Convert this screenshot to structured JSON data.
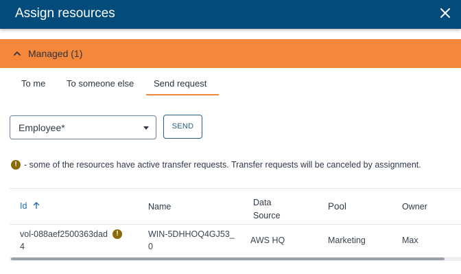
{
  "dialog": {
    "title": "Assign resources",
    "close_icon": "close-icon"
  },
  "section": {
    "label": "Managed (1)",
    "icon": "chevron-up-icon",
    "color": "#f5873a"
  },
  "tabs": [
    {
      "label": "To me",
      "active": false
    },
    {
      "label": "To someone else",
      "active": false
    },
    {
      "label": "Send request",
      "active": true
    }
  ],
  "form": {
    "employee_select": {
      "value": "Employee*"
    },
    "send_label": "SEND"
  },
  "notice": {
    "icon": "warning-icon",
    "text": "- some of the resources have active transfer requests. Transfer requests will be canceled by assignment."
  },
  "table": {
    "columns": {
      "id": "Id",
      "name": "Name",
      "data_source": "Data Source",
      "pool": "Pool",
      "owner": "Owner"
    },
    "sort_icon": "arrow-up-icon",
    "rows": [
      {
        "id": "vol-088aef2500363dad4",
        "warning_icon": "warning-icon",
        "name": "WIN-5DHHOQ4GJ53_0",
        "data_source": "AWS HQ",
        "pool": "Marketing",
        "owner": "Max"
      }
    ]
  },
  "colors": {
    "header": "#024b7a",
    "accent": "#f5873a",
    "warning": "#8a6a08"
  }
}
